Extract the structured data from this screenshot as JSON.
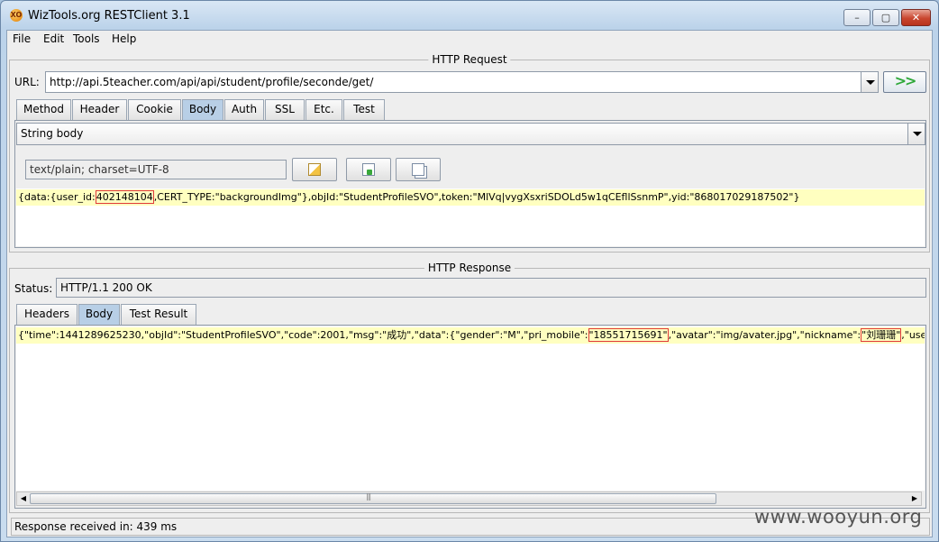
{
  "window": {
    "title": "WizTools.org RESTClient 3.1",
    "app_icon_text": "XO",
    "minimize": "–",
    "maximize": "▢",
    "close": "✕"
  },
  "menu": [
    "File",
    "Edit",
    "Tools",
    "Help"
  ],
  "request": {
    "group_title": "HTTP Request",
    "url_label": "URL:",
    "url_value": "http://api.5teacher.com/api/api/student/profile/seconde/get/",
    "go_label": ">>",
    "tabs": [
      "Method",
      "Header",
      "Cookie",
      "Body",
      "Auth",
      "SSL",
      "Etc.",
      "Test"
    ],
    "active_tab": "Body",
    "body_type": "String body",
    "content_type": "text/plain; charset=UTF-8",
    "body_text": {
      "prefix": "{data:{user_id:",
      "user_id": "402148104",
      "rest": ",CERT_TYPE:\"backgroundImg\"},objId:\"StudentProfileSVO\",token:\"MlVq|vygXsxriSDOLd5w1qCEfllSsnmP\",yid:\"868017029187502\"}"
    }
  },
  "response": {
    "group_title": "HTTP Response",
    "status_label": "Status:",
    "status_value": "HTTP/1.1 200 OK",
    "tabs": [
      "Headers",
      "Body",
      "Test Result"
    ],
    "active_tab": "Body",
    "body_text": {
      "part1": "{\"time\":1441289625230,\"objId\":\"StudentProfileSVO\",\"code\":2001,\"msg\":\"成功\",\"data\":{\"gender\":\"M\",\"pri_mobile\":",
      "mobile": "\"18551715691\"",
      "part2": ",\"avatar\":\"img/avater.jpg\",\"nickname\":",
      "nickname": "\"刘珊珊\"",
      "part3": ",\"user_accour"
    }
  },
  "statusbar": "Response received in: 439 ms",
  "watermark": "www.wooyun.org",
  "colors": {
    "highlight": "#ffffc0",
    "active_tab": "#b8cfe6",
    "redbox": "#e03a3a"
  }
}
